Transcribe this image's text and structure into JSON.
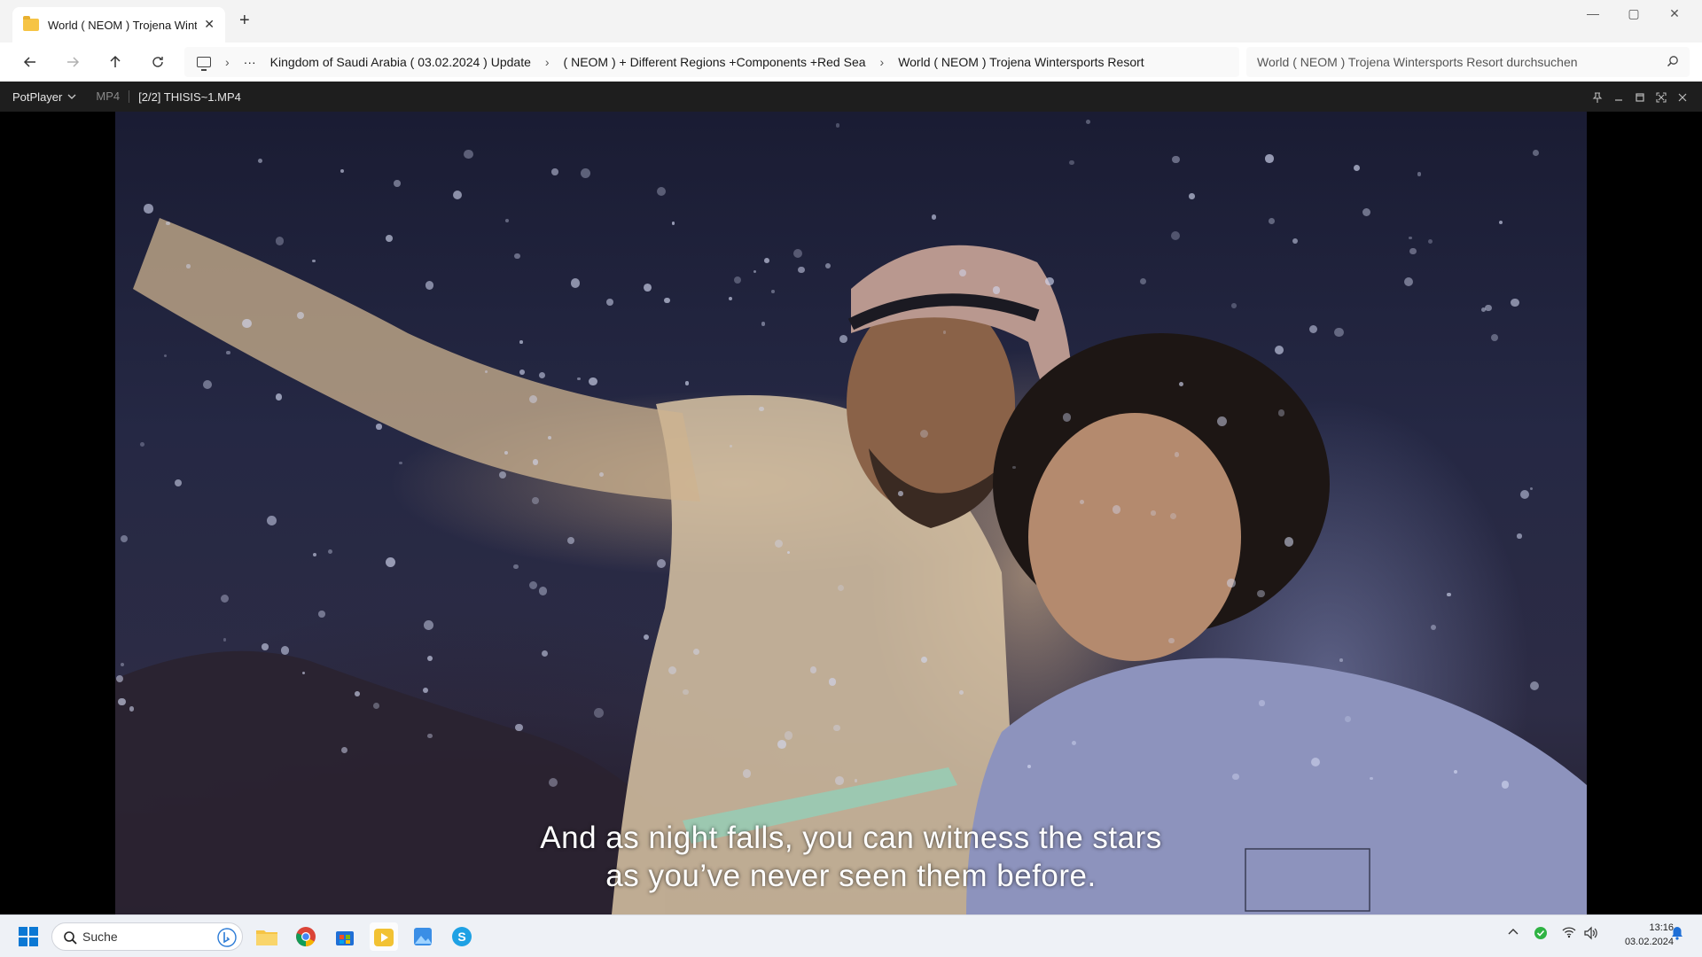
{
  "explorer": {
    "tab_title": "World ( NEOM ) Trojena Winte",
    "breadcrumbs": [
      "Kingdom of Saudi Arabia ( 03.02.2024 ) Update",
      "( NEOM ) + Different Regions +Components +Red Sea",
      "World ( NEOM ) Trojena Wintersports Resort"
    ],
    "overflow_label": "···",
    "search_placeholder": "World ( NEOM ) Trojena Wintersports Resort durchsuchen"
  },
  "player": {
    "app_name": "PotPlayer",
    "format": "MP4",
    "file_label": "[2/2] THISIS~1.MP4",
    "subtitle_line1": "And as night falls, you can witness the stars",
    "subtitle_line2": "as you’ve never seen them before."
  },
  "taskbar": {
    "search_label": "Suche",
    "time": "13:16",
    "date": "03.02.2024",
    "pinned_icons": [
      "start-icon",
      "file-explorer-icon",
      "chrome-icon",
      "store-icon",
      "potplayer-icon",
      "photos-icon",
      "skype-icon"
    ],
    "tray_icons": [
      "chevron-up-icon",
      "shield-icon",
      "wifi-icon",
      "speaker-icon",
      "notification-bell-icon"
    ]
  },
  "colors": {
    "accent": "#0067c0",
    "folder": "#f6c445",
    "player_bar": "#1e1e1e",
    "sky": "#252844"
  }
}
